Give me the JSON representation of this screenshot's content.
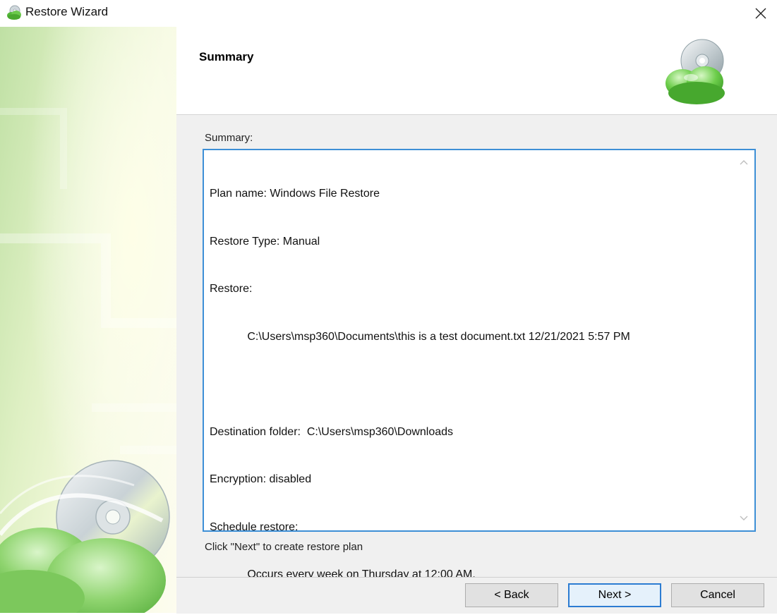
{
  "window": {
    "title": "Restore Wizard",
    "close_glyph": "×"
  },
  "header": {
    "title": "Summary"
  },
  "summary": {
    "label": "Summary:",
    "lines": [
      "Plan name: Windows File Restore",
      "Restore Type: Manual",
      "Restore:",
      "            C:\\Users\\msp360\\Documents\\this is a test document.txt 12/21/2021 5:57 PM",
      "",
      "Destination folder:  C:\\Users\\msp360\\Downloads",
      "Encryption: disabled",
      "Schedule restore:",
      "            Occurs every week on Thursday at 12:00 AM."
    ]
  },
  "hint": "Click \"Next\" to create restore plan",
  "buttons": {
    "back": "< Back",
    "next": "Next >",
    "cancel": "Cancel"
  },
  "colors": {
    "accent": "#3d8fd6",
    "brand_green": "#4caf2e"
  },
  "icons": {
    "app": "cloud-disc-icon",
    "logo": "cloud-disc-logo-icon",
    "close": "close-icon"
  }
}
